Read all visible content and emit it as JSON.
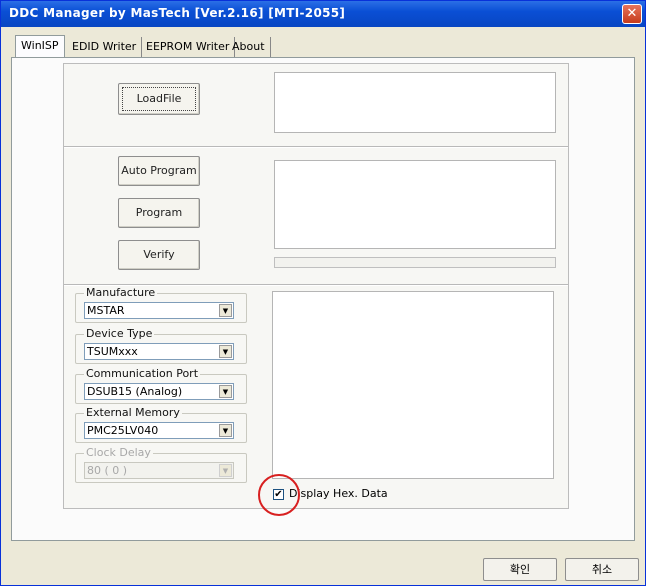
{
  "window": {
    "title": "DDC Manager  by MasTech  [Ver.2.16]  [MTI-2055]",
    "close_glyph": "✕"
  },
  "tabs": [
    {
      "label": "WinISP",
      "active": true
    },
    {
      "label": "EDID Writer"
    },
    {
      "label": "EEPROM Writer"
    },
    {
      "label": "About"
    }
  ],
  "buttons": {
    "load_file": "LoadFile",
    "auto_program": "Auto Program",
    "program": "Program",
    "verify": "Verify"
  },
  "settings": {
    "manufacture": {
      "label": "Manufacture",
      "value": "MSTAR"
    },
    "device_type": {
      "label": "Device Type",
      "value": "TSUMxxx"
    },
    "communication_port": {
      "label": "Communication Port",
      "value": "DSUB15 (Analog)"
    },
    "external_memory": {
      "label": "External Memory",
      "value": "PMC25LV040"
    },
    "clock_delay": {
      "label": "Clock Delay",
      "value": "80 ( 0 )",
      "disabled": true
    }
  },
  "display_hex": {
    "label": "Display Hex. Data",
    "checked": true,
    "check_glyph": "✔"
  },
  "dialog_buttons": {
    "ok": "확인",
    "cancel": "취소"
  },
  "combo_arrow_glyph": "▼"
}
